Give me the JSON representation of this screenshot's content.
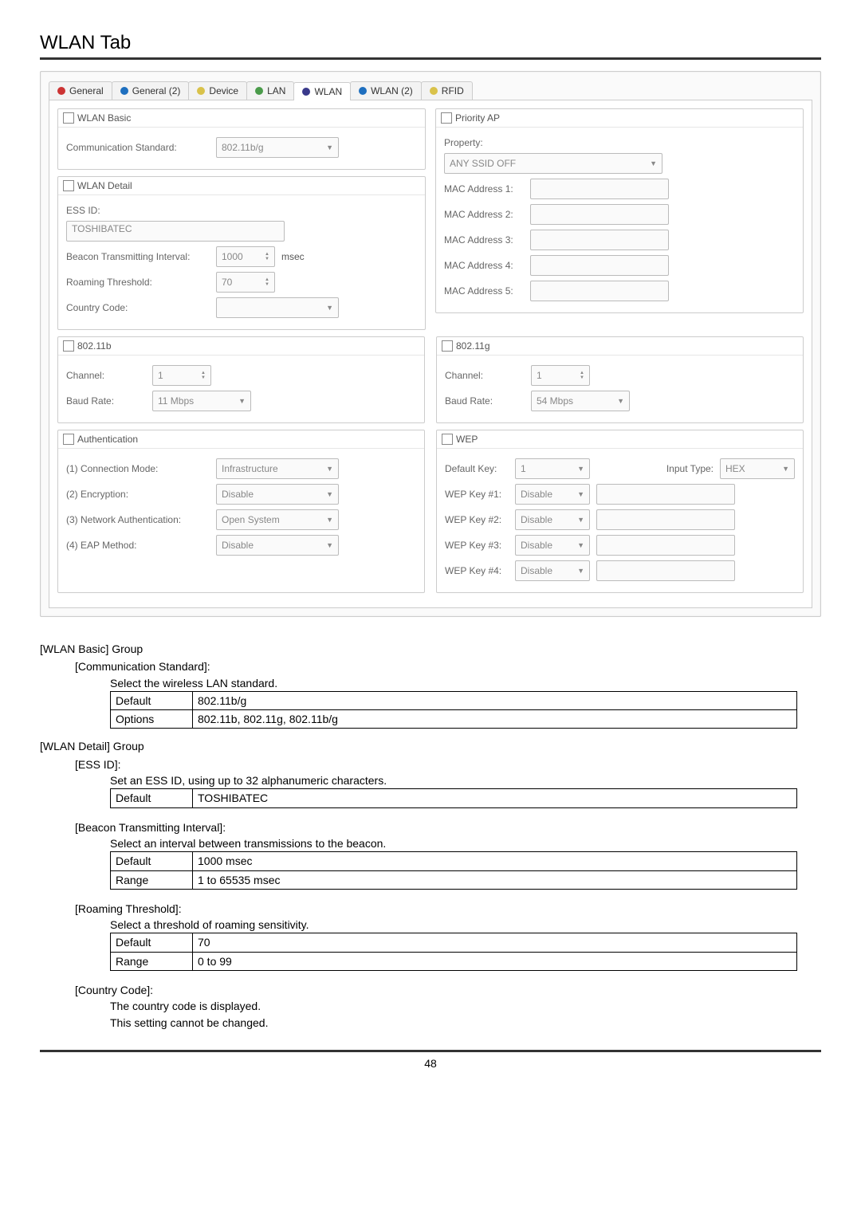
{
  "page": {
    "title": "WLAN Tab",
    "number": "48"
  },
  "tabs": [
    {
      "label": "General",
      "dot": "red"
    },
    {
      "label": "General (2)",
      "dot": "blue"
    },
    {
      "label": "Device",
      "dot": "yellow"
    },
    {
      "label": "LAN",
      "dot": "green"
    },
    {
      "label": "WLAN",
      "dot": "navy"
    },
    {
      "label": "WLAN (2)",
      "dot": "blue"
    },
    {
      "label": "RFID",
      "dot": "yellow"
    }
  ],
  "wlanBasic": {
    "header": "WLAN Basic",
    "commLabel": "Communication Standard:",
    "commValue": "802.11b/g"
  },
  "wlanDetail": {
    "header": "WLAN Detail",
    "essLabel": "ESS ID:",
    "essValue": "TOSHIBATEC",
    "beaconLabel": "Beacon Transmitting Interval:",
    "beaconValue": "1000",
    "beaconUnit": "msec",
    "roamLabel": "Roaming Threshold:",
    "roamValue": "70",
    "countryLabel": "Country Code:",
    "countryValue": ""
  },
  "b": {
    "header": "802.11b",
    "chanLabel": "Channel:",
    "chanValue": "1",
    "baudLabel": "Baud Rate:",
    "baudValue": "11 Mbps"
  },
  "auth": {
    "header": "Authentication",
    "connLabel": "(1) Connection Mode:",
    "connValue": "Infrastructure",
    "encLabel": "(2) Encryption:",
    "encValue": "Disable",
    "netLabel": "(3) Network Authentication:",
    "netValue": "Open System",
    "eapLabel": "(4) EAP Method:",
    "eapValue": "Disable"
  },
  "priorityAp": {
    "header": "Priority AP",
    "propLabel": "Property:",
    "propValue": "ANY SSID OFF",
    "mac1": "MAC Address 1:",
    "mac2": "MAC Address 2:",
    "mac3": "MAC Address 3:",
    "mac4": "MAC Address 4:",
    "mac5": "MAC Address 5:"
  },
  "g": {
    "header": "802.11g",
    "chanLabel": "Channel:",
    "chanValue": "1",
    "baudLabel": "Baud Rate:",
    "baudValue": "54 Mbps"
  },
  "wep": {
    "header": "WEP",
    "defKeyLabel": "Default Key:",
    "defKeyValue": "1",
    "inputTypeLabel": "Input Type:",
    "inputTypeValue": "HEX",
    "k1Label": "WEP Key #1:",
    "k2Label": "WEP Key #2:",
    "k3Label": "WEP Key #3:",
    "k4Label": "WEP Key #4:",
    "kValue": "Disable"
  },
  "doc": {
    "basicHeader": "[WLAN Basic] Group",
    "commHeader": "[Communication Standard]:",
    "commDesc": "Select the wireless LAN standard.",
    "commDefault": "802.11b/g",
    "commOptions": "802.11b, 802.11g, 802.11b/g",
    "detailHeader": "[WLAN Detail] Group",
    "essHeader": "[ESS ID]:",
    "essDesc": "Set an ESS ID, using up to 32 alphanumeric characters.",
    "essDefault": "TOSHIBATEC",
    "beaconHeader": "[Beacon Transmitting Interval]:",
    "beaconDesc": "Select an interval between transmissions to the beacon.",
    "beaconDefault": "1000 msec",
    "beaconRange": "1 to 65535 msec",
    "roamHeader": "[Roaming Threshold]:",
    "roamDesc": "Select a threshold of roaming sensitivity.",
    "roamDefault": "70",
    "roamRange": "0 to 99",
    "countryHeader": "[Country Code]:",
    "countryLine1": "The country code is displayed.",
    "countryLine2": "This setting cannot be changed.",
    "lblDefault": "Default",
    "lblOptions": "Options",
    "lblRange": "Range"
  }
}
